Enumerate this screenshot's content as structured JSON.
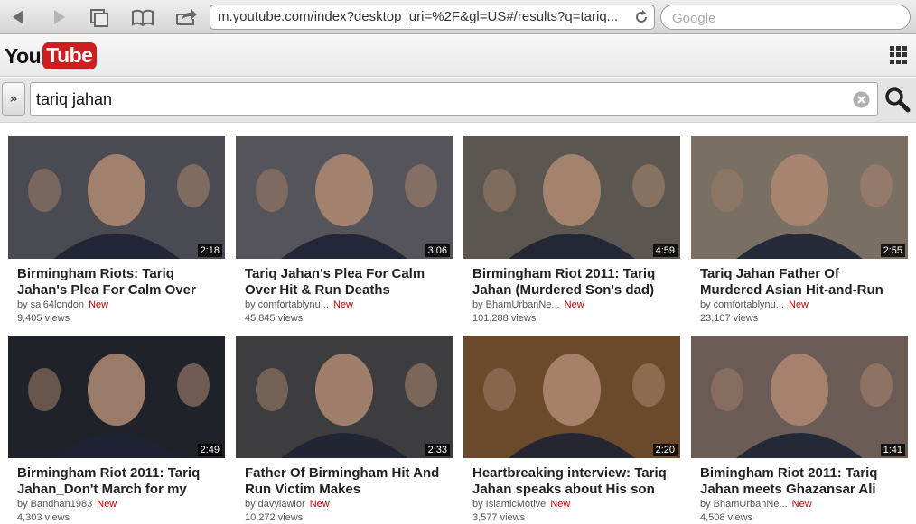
{
  "browser": {
    "url": "m.youtube.com/index?desktop_uri=%2F&gl=US#/results?q=tariq...",
    "search_placeholder": "Google"
  },
  "header": {
    "logo_you": "You",
    "logo_tube": "Tube"
  },
  "search": {
    "query": "tariq jahan"
  },
  "results": [
    {
      "title": "Birmingham Riots: Tariq Jahan's Plea For Calm Over",
      "by": "by sal64london",
      "new_label": "New",
      "views": "9,405 views",
      "duration": "2:18",
      "color": "#4a4a52"
    },
    {
      "title": "Tariq Jahan's Plea For Calm Over Hit & Run Deaths",
      "by": "by comfortablynu...",
      "new_label": "New",
      "views": "45,845 views",
      "duration": "3:06",
      "color": "#55545a"
    },
    {
      "title": "Birmingham Riot 2011: Tariq Jahan (Murdered Son's dad)",
      "by": "by BhamUrbanNe...",
      "new_label": "New",
      "views": "101,288 views",
      "duration": "4:59",
      "color": "#5b5750"
    },
    {
      "title": "Tariq Jahan Father Of Murdered Asian Hit-and-Run",
      "by": "by comfortablynu...",
      "new_label": "New",
      "views": "23,107 views",
      "duration": "2:55",
      "color": "#7a6f63"
    },
    {
      "title": "Birmingham Riot 2011: Tariq Jahan_Don't March for my",
      "by": "by Bandhan1983",
      "new_label": "New",
      "views": "4,303 views",
      "duration": "2:49",
      "color": "#20222a"
    },
    {
      "title": "Father Of Birmingham Hit And Run Victim Makes",
      "by": "by davylawlor",
      "new_label": "New",
      "views": "10,272 views",
      "duration": "2:33",
      "color": "#3d3d40"
    },
    {
      "title": "Heartbreaking interview: Tariq Jahan speaks about His son",
      "by": "by IslamicMotive",
      "new_label": "New",
      "views": "3,577 views",
      "duration": "2:20",
      "color": "#6a4a2a"
    },
    {
      "title": "Bimingham Riot 2011: Tariq Jahan meets Ghazansar Ali",
      "by": "by BhamUrbanNe...",
      "new_label": "New",
      "views": "4,508 views",
      "duration": "1:41",
      "color": "#6b5b55"
    }
  ]
}
